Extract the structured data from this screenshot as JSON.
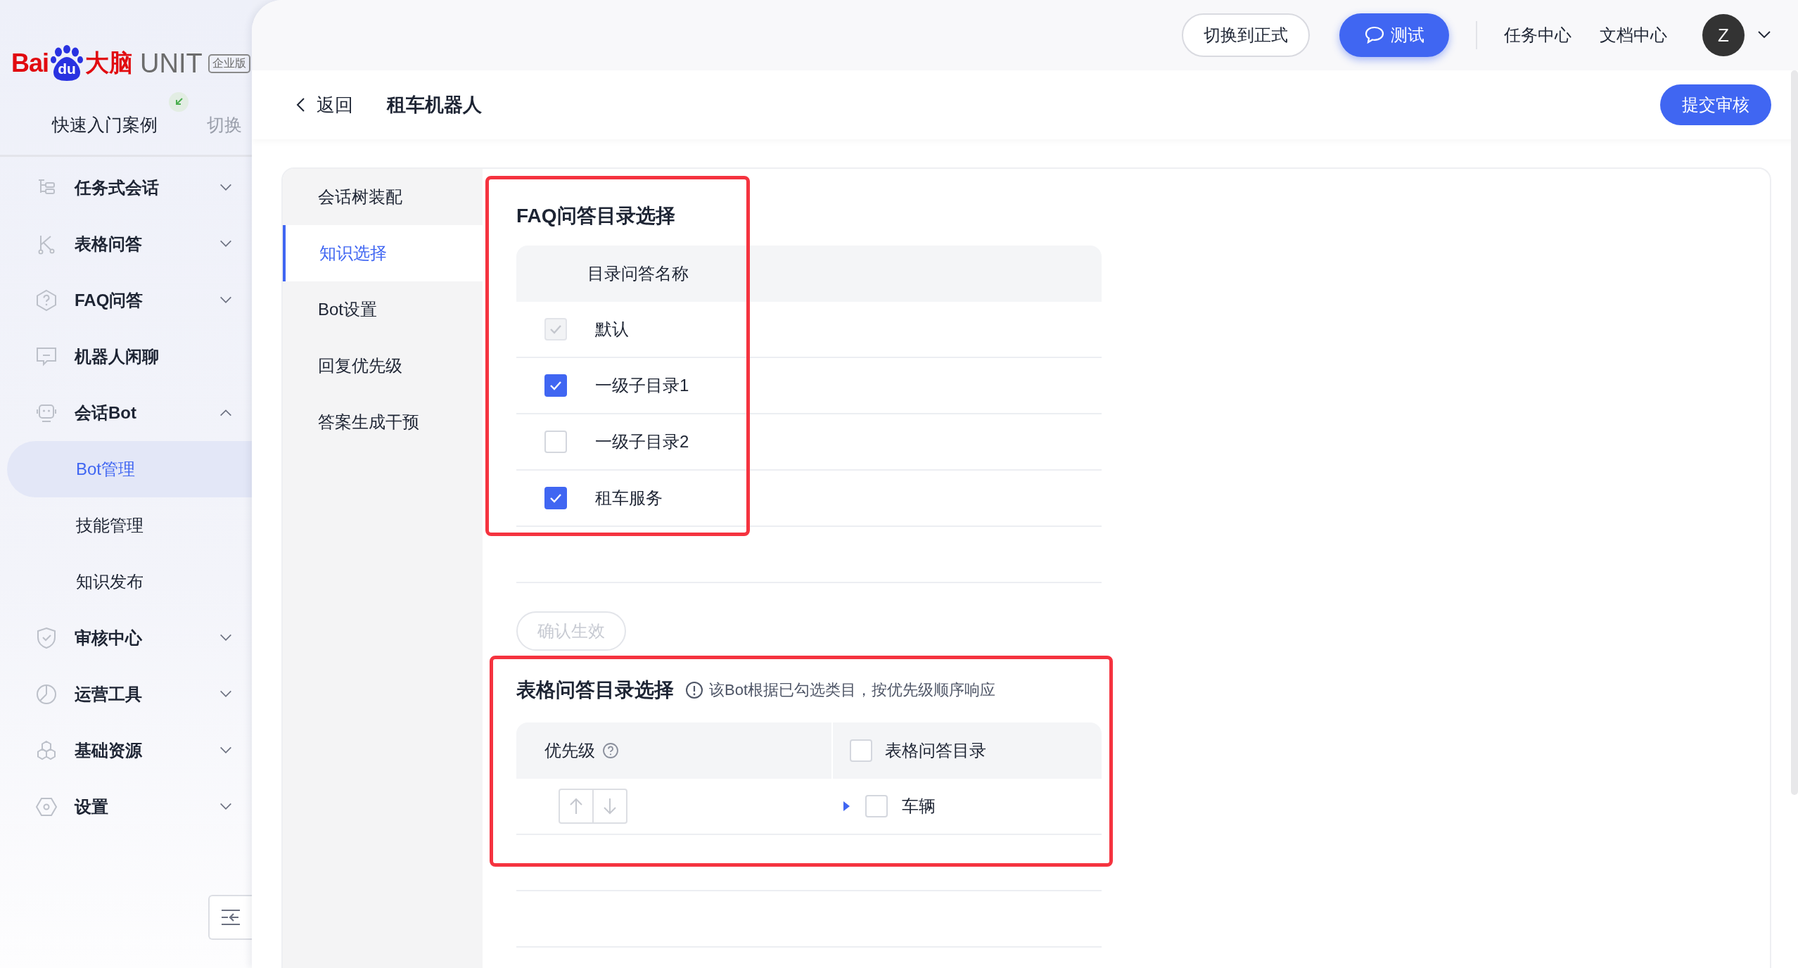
{
  "logo": {
    "brand": "Bai",
    "paw": "du",
    "brand_cn": "大脑",
    "product": "UNIT",
    "edition": "企业版"
  },
  "project": {
    "name": "快速入门案例",
    "switch": "切换"
  },
  "menu": [
    {
      "label": "任务式会话",
      "kind": "group",
      "expanded": false
    },
    {
      "label": "表格问答",
      "kind": "group",
      "expanded": false
    },
    {
      "label": "FAQ问答",
      "kind": "group",
      "expanded": false
    },
    {
      "label": "机器人闲聊",
      "kind": "link"
    },
    {
      "label": "会话Bot",
      "kind": "group",
      "expanded": true,
      "children": [
        {
          "label": "Bot管理",
          "selected": true
        },
        {
          "label": "技能管理",
          "selected": false
        },
        {
          "label": "知识发布",
          "selected": false
        }
      ]
    },
    {
      "label": "审核中心",
      "kind": "group",
      "expanded": false
    },
    {
      "label": "运营工具",
      "kind": "group",
      "expanded": false
    },
    {
      "label": "基础资源",
      "kind": "group",
      "expanded": false
    },
    {
      "label": "设置",
      "kind": "group",
      "expanded": false
    }
  ],
  "topbar": {
    "switch_button": "切换到正式",
    "test_button": "测试",
    "links": [
      "任务中心",
      "文档中心"
    ],
    "avatar": "Z"
  },
  "header": {
    "back": "返回",
    "title": "租车机器人",
    "submit": "提交审核"
  },
  "tabs": [
    {
      "label": "会话树装配",
      "selected": false
    },
    {
      "label": "知识选择",
      "selected": true
    },
    {
      "label": "Bot设置",
      "selected": false
    },
    {
      "label": "回复优先级",
      "selected": false
    },
    {
      "label": "答案生成干预",
      "selected": false
    }
  ],
  "faq": {
    "title": "FAQ问答目录选择",
    "column": "目录问答名称",
    "rows": [
      {
        "name": "默认",
        "checked": true,
        "disabled": true
      },
      {
        "name": "一级子目录1",
        "checked": true,
        "disabled": false
      },
      {
        "name": "一级子目录2",
        "checked": false,
        "disabled": false
      },
      {
        "name": "租车服务",
        "checked": true,
        "disabled": false
      }
    ],
    "confirm": {
      "label": "确认生效",
      "disabled": true
    }
  },
  "table_qa": {
    "title": "表格问答目录选择",
    "hint": "该Bot根据已勾选类目，按优先级顺序响应",
    "columns": [
      "优先级",
      "表格问答目录"
    ],
    "all_checked": false,
    "rows": [
      {
        "name": "车辆",
        "checked": false,
        "expanded": false
      }
    ]
  }
}
